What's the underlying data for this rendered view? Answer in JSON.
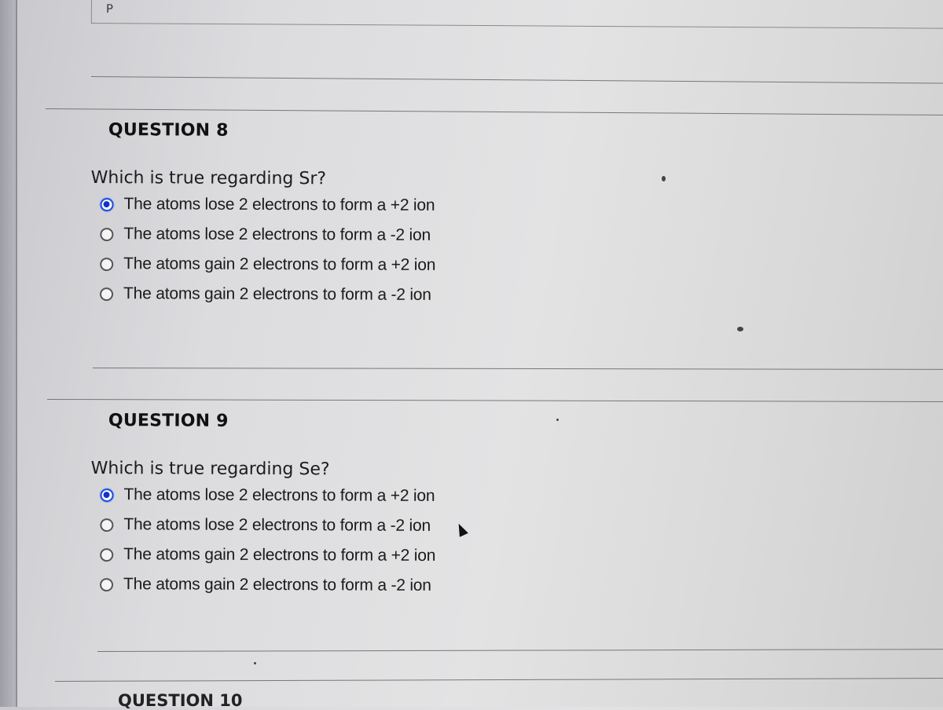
{
  "page": {
    "top_field_text": "P"
  },
  "questions": [
    {
      "title": "QUESTION 8",
      "prompt": "Which is true regarding Sr?",
      "selected_index": 0,
      "options": [
        "The atoms lose 2 electrons to form a +2 ion",
        "The atoms lose 2 electrons to form a -2 ion",
        "The atoms gain 2 electrons to form a +2 ion",
        "The atoms gain 2 electrons to form a -2 ion"
      ]
    },
    {
      "title": "QUESTION 9",
      "prompt": "Which is true regarding Se?",
      "selected_index": 0,
      "options": [
        "The atoms lose 2 electrons to form a +2 ion",
        "The atoms lose 2 electrons to form a -2 ion",
        "The atoms gain 2 electrons to form a +2 ion",
        "The atoms gain 2 electrons to form a -2 ion"
      ]
    },
    {
      "title": "QUESTION 10"
    }
  ],
  "colors": {
    "radio_selected": "#1f4fe0",
    "background": "#dcdcdf"
  }
}
